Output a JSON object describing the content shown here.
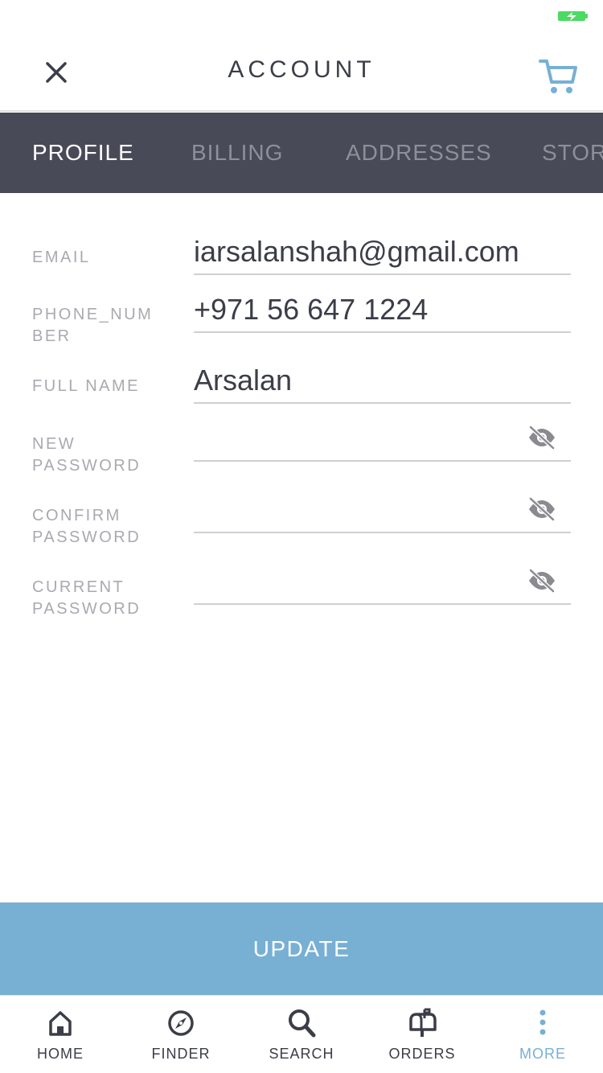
{
  "header": {
    "title": "ACCOUNT"
  },
  "tabs": [
    {
      "label": "PROFILE"
    },
    {
      "label": "BILLING"
    },
    {
      "label": "ADDRESSES"
    },
    {
      "label": "STOR"
    }
  ],
  "form": {
    "email": {
      "label": "EMAIL",
      "value": "iarsalanshah@gmail.com"
    },
    "phone": {
      "label": "PHONE_NUM BER",
      "value": "+971 56 647 1224"
    },
    "full_name": {
      "label": "FULL NAME",
      "value": "Arsalan"
    },
    "new_password": {
      "label": "NEW PASSWORD",
      "value": ""
    },
    "confirm_password": {
      "label": "CONFIRM PASSWORD",
      "value": ""
    },
    "current_password": {
      "label": "CURRENT PASSWORD",
      "value": ""
    }
  },
  "update_label": "UPDATE",
  "bottom_nav": [
    {
      "label": "HOME",
      "icon": "home-icon"
    },
    {
      "label": "FINDER",
      "icon": "compass-icon"
    },
    {
      "label": "SEARCH",
      "icon": "search-icon"
    },
    {
      "label": "ORDERS",
      "icon": "mailbox-icon"
    },
    {
      "label": "MORE",
      "icon": "more-vertical-icon"
    }
  ],
  "colors": {
    "accent": "#77b0d3",
    "tab_bar": "#484a57",
    "battery": "#4cd964"
  }
}
